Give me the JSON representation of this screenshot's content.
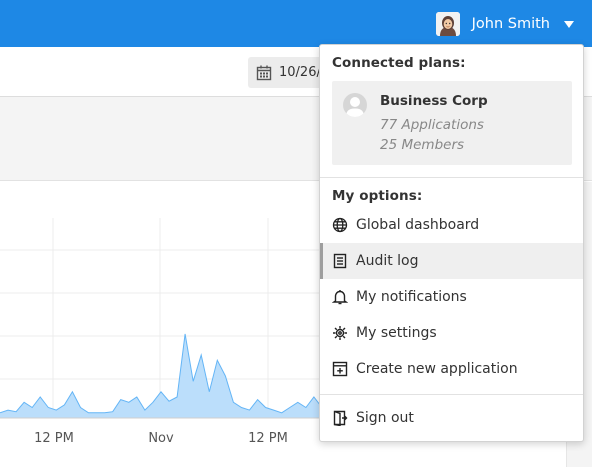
{
  "header": {
    "user_name": "John Smith",
    "background": "#1e88e5"
  },
  "toolbar": {
    "date_text": "10/26/"
  },
  "chart_data": {
    "type": "area",
    "x_tick_labels": [
      "12 PM",
      "Nov",
      "12 PM"
    ],
    "values": [
      1,
      1.5,
      1.2,
      3,
      2,
      4,
      2,
      1.5,
      2.5,
      5,
      2,
      1,
      1,
      1,
      1.2,
      3.5,
      3,
      4,
      1.5,
      3,
      5,
      3.2,
      4,
      16,
      7,
      12,
      5,
      11,
      8,
      3,
      2,
      1.5,
      3.5,
      2,
      1.5,
      1,
      2,
      3,
      2,
      4,
      2,
      1.5
    ],
    "ylim": [
      0,
      40
    ],
    "grid": true,
    "fill": "#bbdefb",
    "stroke": "#64b5f6"
  },
  "menu": {
    "connected_heading": "Connected plans:",
    "plan": {
      "name": "Business Corp",
      "applications": "77 Applications",
      "members": "25 Members"
    },
    "options_heading": "My options:",
    "items": [
      {
        "label": "Global dashboard",
        "icon": "globe-icon"
      },
      {
        "label": "Audit log",
        "icon": "document-icon"
      },
      {
        "label": "My notifications",
        "icon": "bell-icon"
      },
      {
        "label": "My settings",
        "icon": "gear-icon"
      },
      {
        "label": "Create new application",
        "icon": "add-window-icon"
      }
    ],
    "sign_out": {
      "label": "Sign out",
      "icon": "sign-out-icon"
    }
  }
}
